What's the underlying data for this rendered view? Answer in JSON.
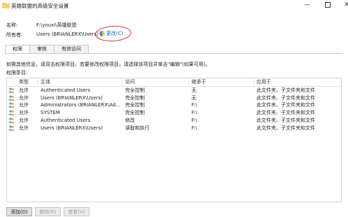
{
  "window": {
    "title": "英雄联盟的高级安全设置",
    "minimize": "—",
    "close": "✕"
  },
  "header": {
    "name_label": "名称:",
    "name_value": "F:\\youxi\\英雄联盟",
    "owner_label": "所有者:",
    "owner_value": "Users (BRIANLERX\\Users)",
    "change_link": "更改(C)"
  },
  "tabs": [
    {
      "label": "权限",
      "active": true
    },
    {
      "label": "审核",
      "active": false
    },
    {
      "label": "有效访问",
      "active": false
    }
  ],
  "info_text": "如需其他信息，请双击权限项目。若要修改权限项目，请选择该项目并单击\"编辑\"(如果可用)。",
  "entries_label": "权限条目:",
  "table": {
    "columns": [
      "类型",
      "主体",
      "访问",
      "继承于",
      "应用于"
    ],
    "rows": [
      {
        "type": "允许",
        "principal": "Authenticated Users",
        "access": "完全控制",
        "inherited": "无",
        "applies": "此文件夹、子文件夹和文件"
      },
      {
        "type": "允许",
        "principal": "Users (BRIANLERX\\Users)",
        "access": "完全控制",
        "inherited": "无",
        "applies": "此文件夹、子文件夹和文件"
      },
      {
        "type": "允许",
        "principal": "Administrators (BRIANLERX\\Ad...",
        "access": "完全控制",
        "inherited": "F:\\",
        "applies": "此文件夹、子文件夹和文件"
      },
      {
        "type": "允许",
        "principal": "SYSTEM",
        "access": "完全控制",
        "inherited": "F:\\",
        "applies": "此文件夹、子文件夹和文件"
      },
      {
        "type": "允许",
        "principal": "Authenticated Users",
        "access": "修改",
        "inherited": "F:\\",
        "applies": "此文件夹、子文件夹和文件"
      },
      {
        "type": "允许",
        "principal": "Users (BRIANLERX\\Users)",
        "access": "读取和执行",
        "inherited": "F:\\",
        "applies": "此文件夹、子文件夹和文件"
      }
    ]
  },
  "buttons": {
    "add": "添加(D)",
    "remove": "删除(R)",
    "view": "查看(V)"
  },
  "colors": {
    "link": "#0066cc",
    "annotation_circle": "#e0282a"
  }
}
